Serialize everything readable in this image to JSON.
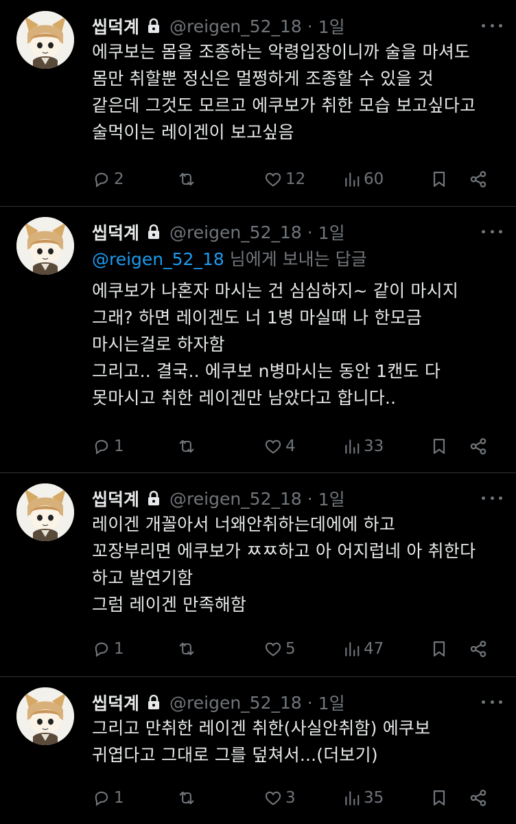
{
  "tweets": [
    {
      "name": "씹덕계",
      "handle": "@reigen_52_18",
      "separator": "·",
      "time": "1일",
      "reply_prefix": "",
      "reply_suffix": "",
      "lines": [
        "에쿠보는 몸을 조종하는 악령입장이니까 술을 마셔도",
        "몸만 취할뿐 정신은 멀쩡하게 조종할 수 있을 것",
        "같은데 그것도 모르고 에쿠보가 취한 모습 보고싶다고",
        "술먹이는 레이겐이 보고싶음"
      ],
      "replies": "2",
      "retweets": "",
      "likes": "12",
      "views": "60"
    },
    {
      "name": "씹덕계",
      "handle": "@reigen_52_18",
      "separator": "·",
      "time": "1일",
      "reply_prefix": "@reigen_52_18",
      "reply_suffix": " 님에게 보내는 답글",
      "lines": [
        "에쿠보가 나혼자 마시는 건 심심하지~ 같이 마시지",
        "그래? 하면 레이겐도 너 1병 마실때 나 한모금",
        "마시는걸로 하자함",
        "그리고.. 결국.. 에쿠보 n병마시는 동안 1캔도 다",
        "못마시고 취한 레이겐만 남았다고 합니다.."
      ],
      "replies": "1",
      "retweets": "",
      "likes": "4",
      "views": "33"
    },
    {
      "name": "씹덕계",
      "handle": "@reigen_52_18",
      "separator": "·",
      "time": "1일",
      "reply_prefix": "",
      "reply_suffix": "",
      "lines": [
        "레이겐 개꼴아서 너왜안취하는데에에 하고",
        "꼬장부리면 에쿠보가 ㅉㅉ하고 아 어지럽네 아 취한다",
        "하고 발연기함",
        "그럼 레이겐 만족해함"
      ],
      "replies": "1",
      "retweets": "",
      "likes": "5",
      "views": "47"
    },
    {
      "name": "씹덕계",
      "handle": "@reigen_52_18",
      "separator": "·",
      "time": "1일",
      "reply_prefix": "",
      "reply_suffix": "",
      "lines": [
        "그리고 만취한 레이겐 취한(사실안취함) 에쿠보",
        "귀엽다고 그대로 그를 덮쳐서...(더보기)"
      ],
      "replies": "1",
      "retweets": "",
      "likes": "3",
      "views": "35"
    }
  ],
  "icons": {
    "reply": "reply-icon",
    "retweet": "retweet-icon",
    "like": "heart-icon",
    "views": "views-icon",
    "bookmark": "bookmark-icon",
    "share": "share-icon",
    "lock": "lock-icon",
    "more": "more-icon"
  },
  "colors": {
    "background": "#000000",
    "text": "#e7e9ea",
    "muted": "#71767b",
    "mention": "#1d9bf0",
    "divider": "#2f3336"
  }
}
